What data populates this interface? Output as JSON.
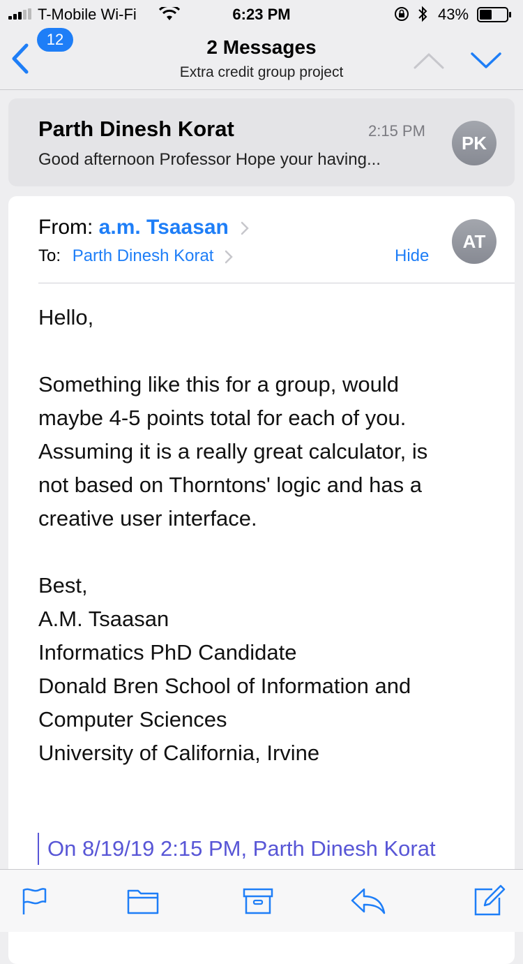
{
  "status_bar": {
    "carrier": "T-Mobile Wi-Fi",
    "time": "6:23 PM",
    "battery": "43%",
    "icons": [
      "signal-icon",
      "wifi-icon",
      "orientation-lock-icon",
      "bluetooth-icon",
      "battery-icon"
    ]
  },
  "nav": {
    "back_count": "12",
    "title": "2 Messages",
    "subtitle": "Extra credit group project"
  },
  "collapsed_message": {
    "sender": "Parth Dinesh Korat",
    "time": "2:15 PM",
    "preview": "Good afternoon Professor Hope your having...",
    "avatar_initials": "PK"
  },
  "expanded_message": {
    "from_label": "From:",
    "from_name": "a.m. Tsaasan",
    "to_label": "To:",
    "to_name": "Parth Dinesh Korat",
    "hide_label": "Hide",
    "avatar_initials": "AT",
    "greeting": "Hello,",
    "paragraph_lines": [
      "Something like this for a group, would",
      "maybe 4-5 points total for each of you.",
      "Assuming it is a really great calculator, is",
      "not based on Thorntons' logic and has a",
      "creative user interface."
    ],
    "signature_lines": [
      "Best,",
      "A.M. Tsaasan",
      "Informatics PhD Candidate",
      "Donald Bren School of Information and",
      "Computer Sciences",
      "University of California, Irvine"
    ],
    "quote_header": "On 8/19/19 2:15 PM, Parth Dinesh Korat"
  },
  "toolbar": {
    "icons": [
      "flag-icon",
      "folder-icon",
      "archive-icon",
      "reply-icon",
      "compose-icon"
    ]
  },
  "colors": {
    "accent": "#1e7ef7",
    "quote": "#5856d6",
    "background": "#eeeef0"
  }
}
